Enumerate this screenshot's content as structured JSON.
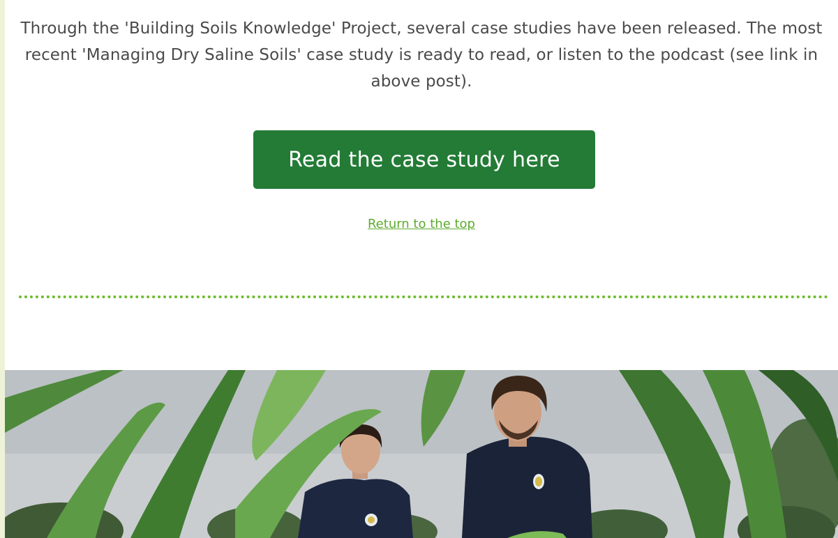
{
  "intro_text": "Through the 'Building Soils Knowledge' Project, several case studies have been released. The most recent 'Managing Dry Saline Soils' case study is ready to read, or listen to the podcast (see link in above post).",
  "cta_button_label": "Read the case study here",
  "return_to_top_label": "Return to the top",
  "colors": {
    "button": "#237b36",
    "link": "#5cab2d",
    "divider": "#6dbb2a",
    "side_strip": "#eef3d8"
  },
  "photo": {
    "subject": "two people in navy t-shirts crouching among green crop leaves under an overcast sky"
  }
}
